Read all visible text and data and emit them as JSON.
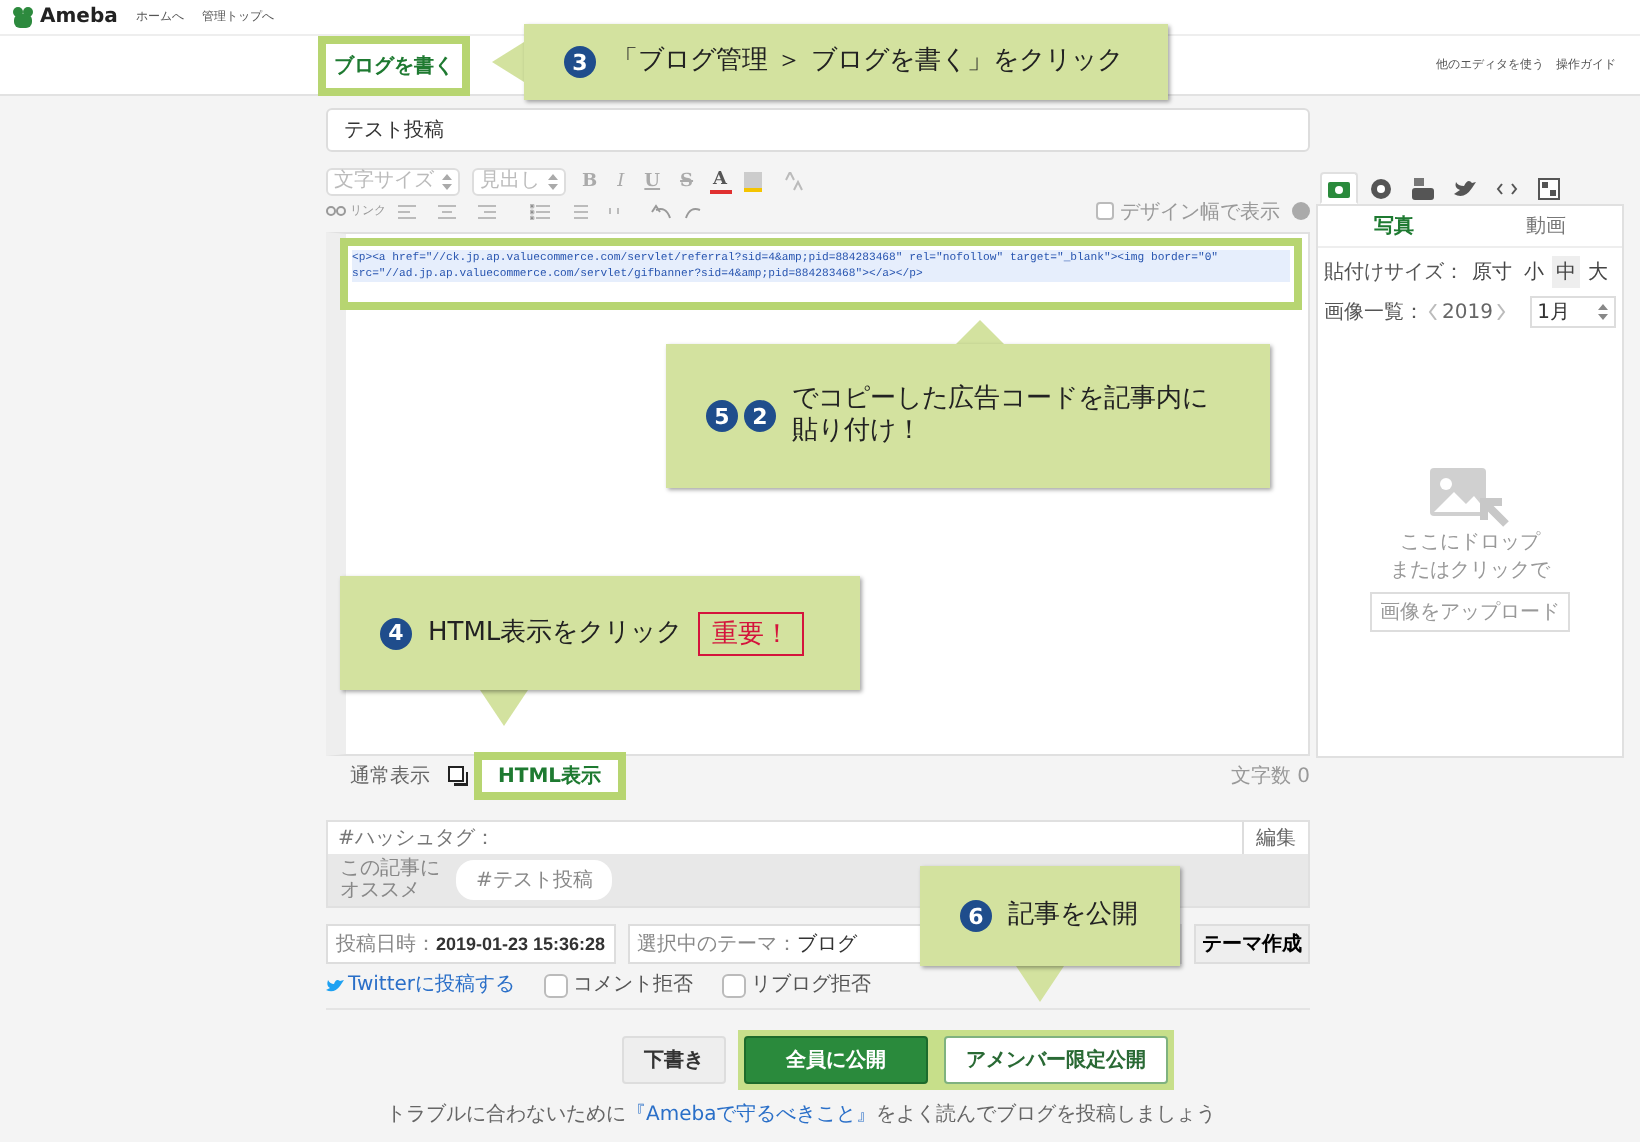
{
  "header": {
    "logo": "Ameba",
    "links": [
      "ホームへ",
      "管理トップへ"
    ]
  },
  "tabs": [
    {
      "label": "ブログを書く",
      "selected": true,
      "highlighted": true
    }
  ],
  "header_links": [
    "他のエディタを使う",
    "操作ガイド"
  ],
  "title_field": {
    "value": "テスト投稿"
  },
  "toolbar": {
    "selects": [
      "文字サイズ",
      "見出し"
    ],
    "format_buttons": [
      "B",
      "I",
      "U",
      "S",
      "A"
    ],
    "link_label": "リンク",
    "design_width": {
      "label": "デザイン幅で表示",
      "checked": false
    }
  },
  "editor": {
    "highlighted": true,
    "code_lines": [
      "<p><a href=\"//ck.jp.ap.valuecommerce.com/servlet/referral?sid=4&amp;pid=884283468\" rel=\"nofollow\" target=\"_blank\"><img border=\"0\"",
      "src=\"//ad.jp.ap.valuecommerce.com/servlet/gifbanner?sid=4&amp;pid=884283468\"></a></p>"
    ]
  },
  "view_modes": [
    {
      "label": "通常表示",
      "selected": false,
      "highlighted": false
    },
    {
      "label": "HTML表示",
      "selected": true,
      "highlighted": true
    }
  ],
  "char_count": "文字数 0",
  "media_panel": {
    "media_tabs": [
      {
        "kind": "camera",
        "selected": true
      },
      {
        "kind": "emoji",
        "selected": false
      },
      {
        "kind": "video",
        "selected": false
      },
      {
        "kind": "twitter",
        "selected": false
      },
      {
        "kind": "embed",
        "selected": false
      },
      {
        "kind": "qr",
        "selected": false
      }
    ],
    "sub_tabs": [
      {
        "label": "写真",
        "selected": true
      },
      {
        "label": "動画",
        "selected": false
      }
    ],
    "size_label": "貼付けサイズ：",
    "sizes": [
      {
        "label": "原寸",
        "selected": false
      },
      {
        "label": "小",
        "selected": false
      },
      {
        "label": "中",
        "selected": true
      },
      {
        "label": "大",
        "selected": false
      }
    ],
    "list_label": "画像一覧：",
    "year": "2019",
    "month": "1月",
    "drop_lines": [
      "ここにドロップ",
      "またはクリックで"
    ],
    "upload_button": "画像をアップロード"
  },
  "hashtags": {
    "placeholder": "#ハッシュタグ：",
    "edit_button": "編集",
    "recommend_label": "この記事にオススメ",
    "chips": [
      "#テスト投稿"
    ]
  },
  "post_date": {
    "label": "投稿日時：",
    "value": "2019-01-23 15:36:28"
  },
  "theme": {
    "label": "選択中のテーマ：",
    "value": "ブログ"
  },
  "theme_button": "テーマ作成",
  "twitter_link": "Twitterに投稿する",
  "options": [
    {
      "label": "コメント拒否",
      "checked": false
    },
    {
      "label": "リブログ拒否",
      "checked": false
    }
  ],
  "actions": [
    {
      "label": "下書き",
      "kind": "draft"
    },
    {
      "label": "全員に公開",
      "kind": "primary"
    },
    {
      "label": "アメンバー限定公開",
      "kind": "secondary"
    }
  ],
  "publish_highlighted": true,
  "footer": {
    "before": "トラブルに合わないために",
    "link": "『Amebaで守るべきこと』",
    "after": "をよく読んでブログを投稿しましょう"
  },
  "callouts": [
    {
      "badges": [
        "3"
      ],
      "text": "「ブログ管理 ＞ ブログを書く」をクリック"
    },
    {
      "badges": [
        "5",
        "2"
      ],
      "text": "でコピーした広告コードを記事内に貼り付け！"
    },
    {
      "badges": [
        "4"
      ],
      "text": "HTML表示をクリック",
      "tag": "重要！"
    },
    {
      "badges": [
        "6"
      ],
      "text": "記事を公開"
    }
  ]
}
